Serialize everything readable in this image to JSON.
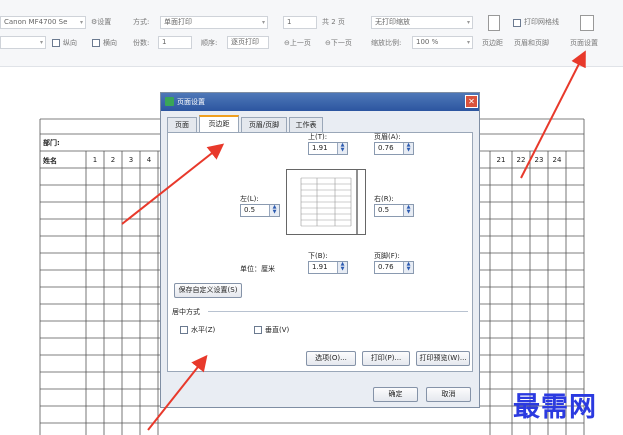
{
  "ribbon": {
    "printer": "Canon MF4700 Se",
    "settings_btn": "设置",
    "method_label": "方式:",
    "method_value": "单面打印",
    "page_num": "1",
    "total_pages": "共 2 页",
    "no_scale": "无打印缩放",
    "print_gridlines": "打印网格线",
    "portrait": "纵向",
    "landscape": "横向",
    "copies_label": "份数:",
    "copies_value": "1",
    "order_label": "顺序:",
    "order_value": "逐页打印",
    "prev_page": "上一页",
    "next_page": "下一页",
    "zoom_label": "缩放比例:",
    "zoom_value": "100 %",
    "margins_btn": "页边距",
    "header_footer_btn": "页眉和页脚",
    "page_setup_btn": "页面设置"
  },
  "sheet": {
    "dept_label": "部门:",
    "name_label": "姓名",
    "left_cols": [
      "1",
      "2",
      "3",
      "4"
    ],
    "right_cols": [
      "21",
      "22",
      "23",
      "24"
    ]
  },
  "dialog": {
    "title": "页面设置",
    "tabs": [
      "页面",
      "页边距",
      "页眉/页脚",
      "工作表"
    ],
    "top_label": "上(T):",
    "top_value": "1.91",
    "header_label": "页眉(A):",
    "header_value": "0.76",
    "left_label": "左(L):",
    "left_value": "0.5",
    "right_label": "右(R):",
    "right_value": "0.5",
    "bottom_label": "下(B):",
    "bottom_value": "1.91",
    "footer_label": "页脚(F):",
    "footer_value": "0.76",
    "unit_label": "单位：厘米",
    "save_custom": "保存自定义设置(S)",
    "center_section": "居中方式",
    "horizontal": "水平(Z)",
    "vertical": "垂直(V)",
    "options_btn": "选项(O)...",
    "print_btn": "打印(P)...",
    "preview_btn": "打印预览(W)...",
    "ok_btn": "确定",
    "cancel_btn": "取消"
  },
  "watermark": "最需网",
  "colors": {
    "arrow": "#e8392b",
    "title_bar": "#2c55a0",
    "accent_tab": "#f0a020"
  }
}
